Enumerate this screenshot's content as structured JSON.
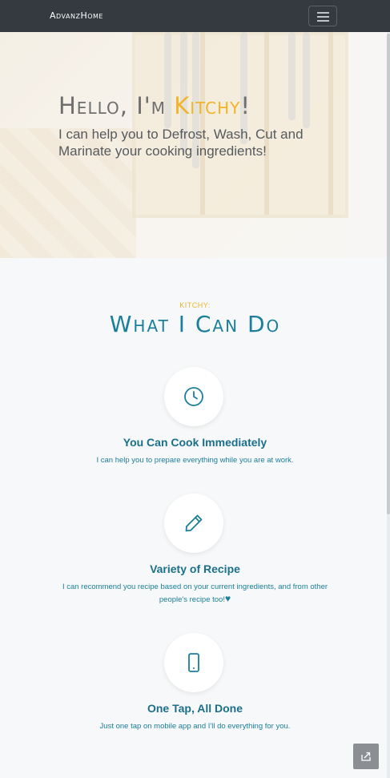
{
  "navbar": {
    "brand": "AdvanzHome",
    "menu_icon": "hamburger-icon"
  },
  "hero": {
    "title_prefix": "Hello, I'm ",
    "title_accent": "Kitchy",
    "title_suffix": "!",
    "subtitle": "I can help you to Defrost, Wash, Cut and Marinate your cooking ingredients!"
  },
  "features_section": {
    "kicker": "KITCHY:",
    "title": "What I Can Do",
    "items": [
      {
        "icon": "clock-icon",
        "heading": "You Can Cook Immediately",
        "description": "I can help you to prepare everything while you are at work."
      },
      {
        "icon": "pencil-icon",
        "heading": "Variety of Recipe",
        "description": "I can recommend you recipe based on your current ingredients, and from other people's recipe too!",
        "description_suffix": "♥"
      },
      {
        "icon": "mobile-phone-icon",
        "heading": "One Tap, All Done",
        "description": "Just one tap on mobile app and I'll do everything for you."
      }
    ]
  },
  "floating_button": {
    "icon": "share-icon"
  },
  "colors": {
    "accent": "#f0b429",
    "primary": "#1b7e9a",
    "navbar": "#343a40"
  }
}
